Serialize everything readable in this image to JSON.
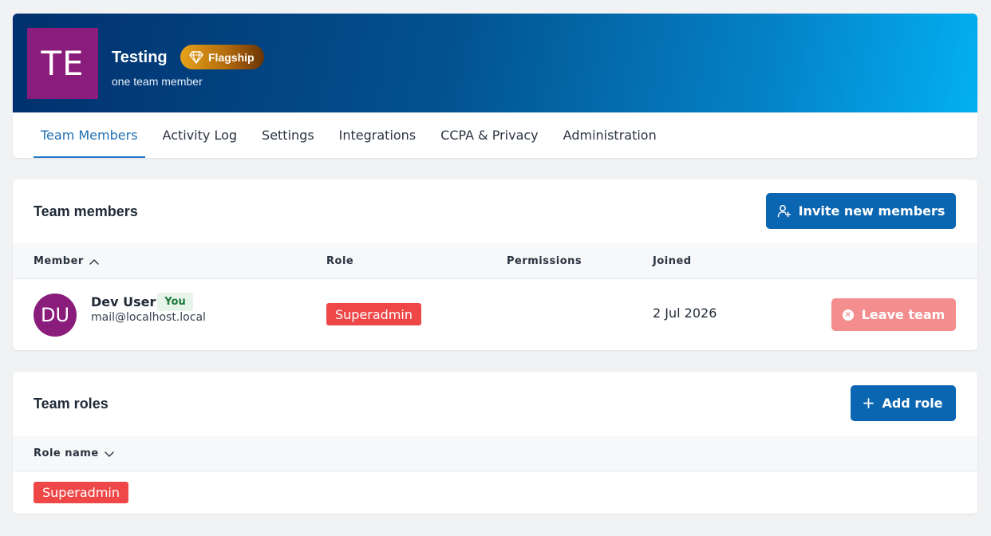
{
  "team": {
    "avatar_initials": "TE",
    "name": "Testing",
    "plan": "Flagship",
    "subtitle": "one team member",
    "avatar_color": "#8a1c7c"
  },
  "tabs": [
    {
      "label": "Team Members",
      "active": true
    },
    {
      "label": "Activity Log",
      "active": false
    },
    {
      "label": "Settings",
      "active": false
    },
    {
      "label": "Integrations",
      "active": false
    },
    {
      "label": "CCPA & Privacy",
      "active": false
    },
    {
      "label": "Administration",
      "active": false
    }
  ],
  "members_section": {
    "title": "Team members",
    "invite_button": "Invite new members",
    "columns": {
      "member": "Member",
      "role": "Role",
      "permissions": "Permissions",
      "joined": "Joined"
    },
    "rows": [
      {
        "initials": "DU",
        "name": "Dev User",
        "you_badge": "You",
        "email": "mail@localhost.local",
        "role": "Superadmin",
        "permissions": "",
        "joined": "2 Jul 2026",
        "action": "Leave team"
      }
    ]
  },
  "roles_section": {
    "title": "Team roles",
    "add_button": "Add role",
    "columns": {
      "role_name": "Role name"
    },
    "rows": [
      {
        "role": "Superadmin"
      }
    ]
  },
  "colors": {
    "primary": "#0b66b1",
    "danger": "#ef4747",
    "leave_button": "#f48e8e",
    "active_tab": "#1f6fb5"
  }
}
